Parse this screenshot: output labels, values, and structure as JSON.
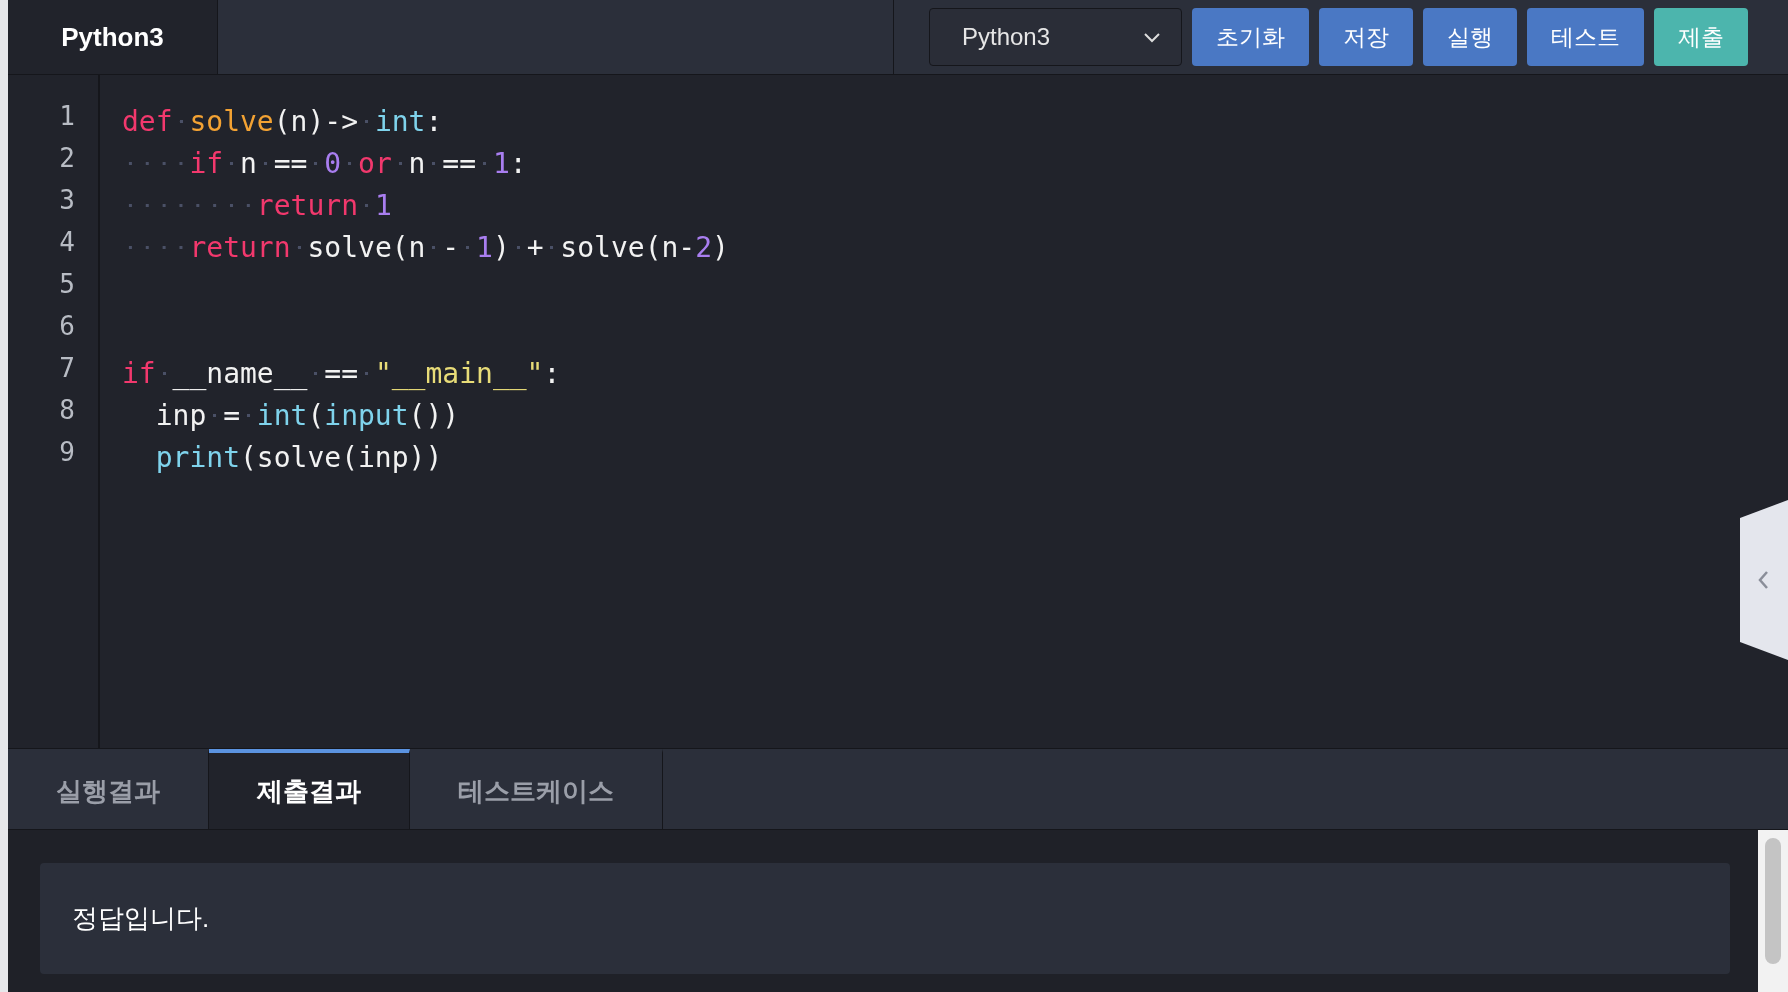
{
  "editor_tab": {
    "label": "Python3"
  },
  "language_select": {
    "value": "Python3"
  },
  "buttons": [
    {
      "label": "초기화",
      "kind": "primary"
    },
    {
      "label": "저장",
      "kind": "primary"
    },
    {
      "label": "실행",
      "kind": "primary"
    },
    {
      "label": "테스트",
      "kind": "primary"
    },
    {
      "label": "제출",
      "kind": "submit"
    }
  ],
  "code_lines": [
    {
      "number": "1",
      "tab_indent": false,
      "tokens": [
        {
          "text": "def ",
          "color": "#f2386d"
        },
        {
          "text": "solve",
          "color": "#f3a233"
        },
        {
          "text": "(n)-> ",
          "color": "#f2f2f2"
        },
        {
          "text": "int",
          "color": "#7fd3ec"
        },
        {
          "text": ":",
          "color": "#f2f2f2"
        }
      ]
    },
    {
      "number": "2",
      "tab_indent": false,
      "tokens": [
        {
          "text": "    if ",
          "color": "#f2386d"
        },
        {
          "text": "n == ",
          "color": "#f2f2f2"
        },
        {
          "text": "0 ",
          "color": "#a97ef0"
        },
        {
          "text": "or ",
          "color": "#f2386d"
        },
        {
          "text": "n == ",
          "color": "#f2f2f2"
        },
        {
          "text": "1",
          "color": "#a97ef0"
        },
        {
          "text": ":",
          "color": "#f2f2f2"
        }
      ]
    },
    {
      "number": "3",
      "tab_indent": false,
      "tokens": [
        {
          "text": "        return ",
          "color": "#f2386d"
        },
        {
          "text": "1",
          "color": "#a97ef0"
        }
      ]
    },
    {
      "number": "4",
      "tab_indent": false,
      "tokens": [
        {
          "text": "    return ",
          "color": "#f2386d"
        },
        {
          "text": "solve(n - ",
          "color": "#f2f2f2"
        },
        {
          "text": "1",
          "color": "#a97ef0"
        },
        {
          "text": ") + solve(n-",
          "color": "#f2f2f2"
        },
        {
          "text": "2",
          "color": "#a97ef0"
        },
        {
          "text": ")",
          "color": "#f2f2f2"
        }
      ]
    },
    {
      "number": "5",
      "tab_indent": false
    },
    {
      "number": "6",
      "tab_indent": false
    },
    {
      "number": "7",
      "tab_indent": false,
      "tokens": [
        {
          "text": "if ",
          "color": "#f2386d"
        },
        {
          "text": "__name__ == ",
          "color": "#f2f2f2"
        },
        {
          "text": "\"__main__\"",
          "color": "#e8dc78"
        },
        {
          "text": ":",
          "color": "#f2f2f2"
        }
      ]
    },
    {
      "number": "8",
      "tab_indent": true,
      "tokens": [
        {
          "text": "inp = ",
          "color": "#f2f2f2"
        },
        {
          "text": "int",
          "color": "#7fd3ec"
        },
        {
          "text": "(",
          "color": "#f2f2f2"
        },
        {
          "text": "input",
          "color": "#7fd3ec"
        },
        {
          "text": "())",
          "color": "#f2f2f2"
        }
      ]
    },
    {
      "number": "9",
      "tab_indent": true,
      "tokens": [
        {
          "text": "print",
          "color": "#7fd3ec"
        },
        {
          "text": "(solve(inp))",
          "color": "#f2f2f2"
        }
      ]
    }
  ],
  "result_tabs": [
    {
      "label": "실행결과",
      "selected": false
    },
    {
      "label": "제출결과",
      "selected": true
    },
    {
      "label": "테스트케이스",
      "selected": false
    }
  ],
  "result": {
    "message": "정답입니다."
  }
}
